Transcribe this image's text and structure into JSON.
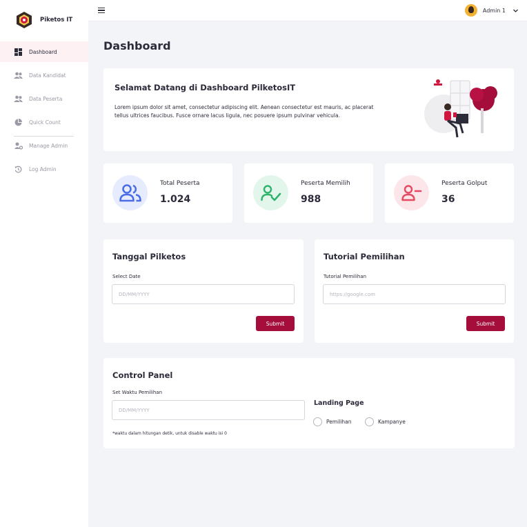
{
  "brand": {
    "name": "Piketos IT"
  },
  "sidebar": {
    "items": [
      {
        "label": "Dashboard",
        "icon": "dashboard-icon",
        "active": true
      },
      {
        "label": "Data Kandidat",
        "icon": "users-icon",
        "active": false
      },
      {
        "label": "Data Peserta",
        "icon": "users-icon",
        "active": false
      },
      {
        "label": "Quick Count",
        "icon": "pie-chart-icon",
        "active": false
      },
      {
        "label": "Manage Admin",
        "icon": "user-settings-icon",
        "active": false
      },
      {
        "label": "Log Admin",
        "icon": "history-icon",
        "active": false
      }
    ]
  },
  "topbar": {
    "user_name": "Admin 1"
  },
  "page": {
    "title": "Dashboard"
  },
  "welcome": {
    "title": "Selamat Datang di Dashboard PilketosIT",
    "body": "Lorem ipsum dolor sit amet, consectetur adipiscing elit. Aenean consectetur est mauris, ac placerat tellus ultrices faucibus. Fusce ornare lacus ligula, nec posuere ipsum pulvinar vehicula."
  },
  "stats": [
    {
      "label": "Total Peserta",
      "value": "1.024",
      "icon": "users-icon",
      "color": "#4a6de5",
      "bg": "#e6ecfd"
    },
    {
      "label": "Peserta Memilih",
      "value": "988",
      "icon": "user-check-icon",
      "color": "#2fb36b",
      "bg": "#e3f6ec"
    },
    {
      "label": "Peserta Golput",
      "value": "36",
      "icon": "user-minus-icon",
      "color": "#e5495f",
      "bg": "#fde6ea"
    }
  ],
  "tanggal": {
    "title": "Tanggal Pilketos",
    "field_label": "Select Date",
    "placeholder": "DD/MM/YYYY",
    "submit_label": "Submit"
  },
  "tutorial": {
    "title": "Tutorial Pemilihan",
    "field_label": "Tutorial Pemilihan",
    "placeholder": "https://google.com",
    "submit_label": "Submit"
  },
  "control_panel": {
    "title": "Control Panel",
    "field_label": "Set Waktu Pemilihan",
    "placeholder": "DD/MM/YYYY",
    "hint": "*waktu dalam hitungan detik, untuk disable waktu isi 0",
    "landing_title": "Landing Page",
    "options": [
      "Pemilihan",
      "Kampanye"
    ]
  },
  "colors": {
    "accent": "#a50e3b",
    "background": "#f3f4f7"
  }
}
